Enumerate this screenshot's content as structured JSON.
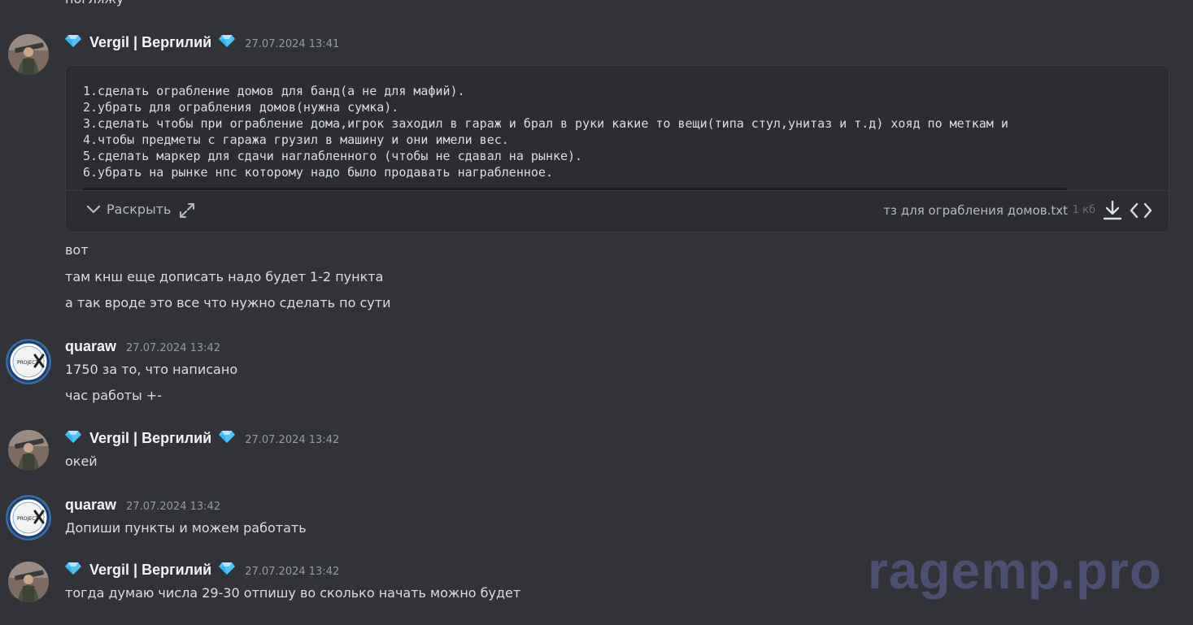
{
  "top_partial_text": "погляжу",
  "messages": [
    {
      "author": "Vergil | Вергилий",
      "timestamp": "27.07.2024 13:41",
      "attachment": {
        "lines": [
          "1.сделать ограбление домов для банд(а не для мафий).",
          "2.убрать для ограбления домов(нужна сумка).",
          "3.сделать чтобы при ограбление дома,игрок заходил в гараж и брал в руки какие то вещи(типа стул,унитаз и т.д) хояд по меткам и",
          "4.чтобы предметы с гаража грузил в машину и они имели вес.",
          "5.сделать маркер для сдачи наглабленного (чтобы не сдавал на рынке).",
          "6.убрать на рынке нпс которому надо было продавать награбленное."
        ],
        "expand_label": "Раскрыть",
        "file_name": "тз для ограбления домов.txt",
        "file_size": "1 кб"
      },
      "lines": [
        "вот",
        "там кнш еще дописать надо будет 1-2 пункта",
        "а так вроде это все что нужно сделать по сути"
      ]
    },
    {
      "author": "quaraw",
      "timestamp": "27.07.2024 13:42",
      "avatar_text": "PROJECT",
      "lines": [
        "1750 за то, что написано",
        "час работы +-"
      ]
    },
    {
      "author": "Vergil | Вергилий",
      "timestamp": "27.07.2024 13:42",
      "lines": [
        "окей"
      ]
    },
    {
      "author": "quaraw",
      "timestamp": "27.07.2024 13:42",
      "avatar_text": "PROJECT",
      "lines": [
        "Допиши пункты и можем работать"
      ]
    },
    {
      "author": "Vergil | Вергилий",
      "timestamp": "27.07.2024 13:42",
      "lines": [
        "тогда думаю числа 29-30 отпишу во сколько начать можно будет"
      ]
    }
  ],
  "watermark": "ragemp.pro",
  "colors": {
    "background": "#323339",
    "text": "#dbdee1",
    "muted": "#949ba4",
    "attachment_bg": "#2b2d31",
    "gem": "#4fc3f7",
    "watermark": "#4b5073"
  },
  "icons": {
    "gem": "gem-icon",
    "expand": "chevron-down-icon",
    "fullscreen": "expand-arrows-icon",
    "download": "download-icon",
    "view_code": "code-icon"
  }
}
